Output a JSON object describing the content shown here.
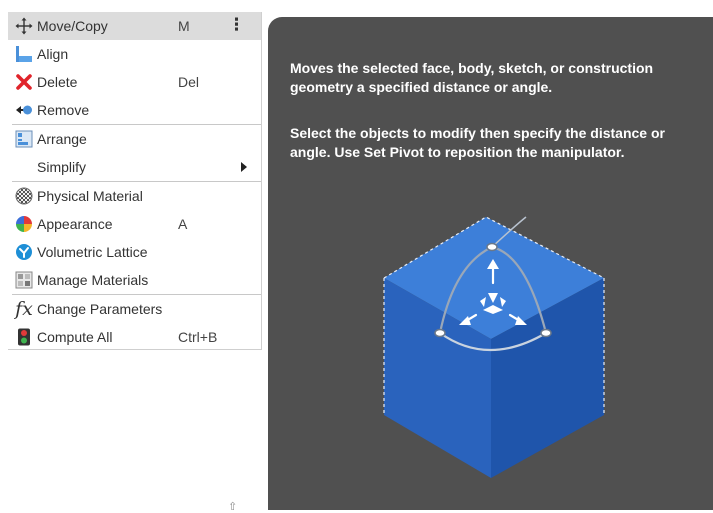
{
  "menu": {
    "items": [
      {
        "label": "Move/Copy",
        "shortcut": "M",
        "icon": "move-icon",
        "highlighted": true,
        "has_more": true
      },
      {
        "label": "Align",
        "shortcut": "",
        "icon": "align-icon"
      },
      {
        "label": "Delete",
        "shortcut": "Del",
        "icon": "delete-x-icon"
      },
      {
        "label": "Remove",
        "shortcut": "",
        "icon": "remove-icon"
      },
      {
        "label": "Arrange",
        "shortcut": "",
        "icon": "arrange-icon"
      },
      {
        "label": "Simplify",
        "shortcut": "",
        "icon": "",
        "submenu": true
      },
      {
        "label": "Physical Material",
        "shortcut": "",
        "icon": "physical-material-icon"
      },
      {
        "label": "Appearance",
        "shortcut": "A",
        "icon": "appearance-icon"
      },
      {
        "label": "Volumetric Lattice",
        "shortcut": "",
        "icon": "volumetric-lattice-icon"
      },
      {
        "label": "Manage Materials",
        "shortcut": "",
        "icon": "manage-materials-icon"
      },
      {
        "label": "Change Parameters",
        "shortcut": "",
        "icon": "fx-icon"
      },
      {
        "label": "Compute All",
        "shortcut": "Ctrl+B",
        "icon": "compute-all-icon"
      }
    ],
    "more_glyph": "⋮",
    "fx_glyph": "fx"
  },
  "tooltip": {
    "line1": "Moves the selected face, body, sketch, or construction geometry a specified distance or angle.",
    "line2": "Select the objects to modify then specify the distance or angle. Use Set Pivot to reposition the manipulator."
  },
  "colors": {
    "menu_highlight": "#dcdcdc",
    "tooltip_bg": "#505050",
    "cube_blue": "#2f6fcc",
    "delete_red": "#e0242b"
  }
}
